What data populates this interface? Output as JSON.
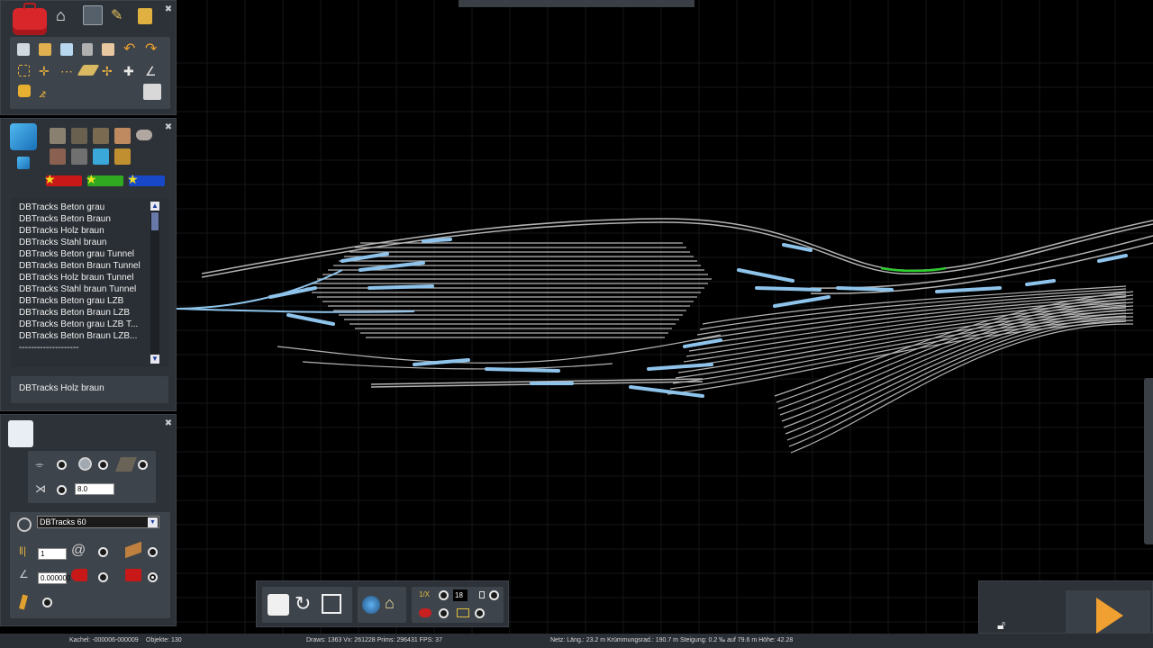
{
  "track_list": {
    "items": [
      "DBTracks Beton grau",
      "DBTracks Beton Braun",
      "DBTracks Holz braun",
      "DBTracks Stahl braun",
      "DBTracks Beton grau Tunnel",
      "DBTracks Beton Braun Tunnel",
      "DBTracks Holz braun Tunnel",
      "DBTracks Stahl braun Tunnel",
      "DBTracks Beton grau LZB",
      "DBTracks Beton Braun LZB",
      "DBTracks Beton grau LZB T...",
      "DBTracks Beton Braun LZB...",
      "--------------------"
    ],
    "selected": "DBTracks Holz braun"
  },
  "track_options": {
    "value_field": "8.0"
  },
  "track_props": {
    "track_type": "DBTracks 60",
    "count_value": "1",
    "slope_value": "0.000000"
  },
  "bottom_toolbar": {
    "speed_value": "18"
  },
  "status": {
    "tile": "Kachel: -000006-000009",
    "objects": "Objekte: 130",
    "draws": "Draws: 1363 Vx: 261228 Prims: 296431 FPS: 37",
    "net": "Netz:  Läng.:  23.2 m Krümmungsrad.: 190.7 m Steigung:  0.2 ‰ auf 79.6 m Höhe:  42.28"
  },
  "colors": {
    "track": "#b4b4b4",
    "switch": "#8ec4ec",
    "selected_track": "#2ecc2e",
    "panel": "#2d3238",
    "accent_play": "#f0a030"
  }
}
